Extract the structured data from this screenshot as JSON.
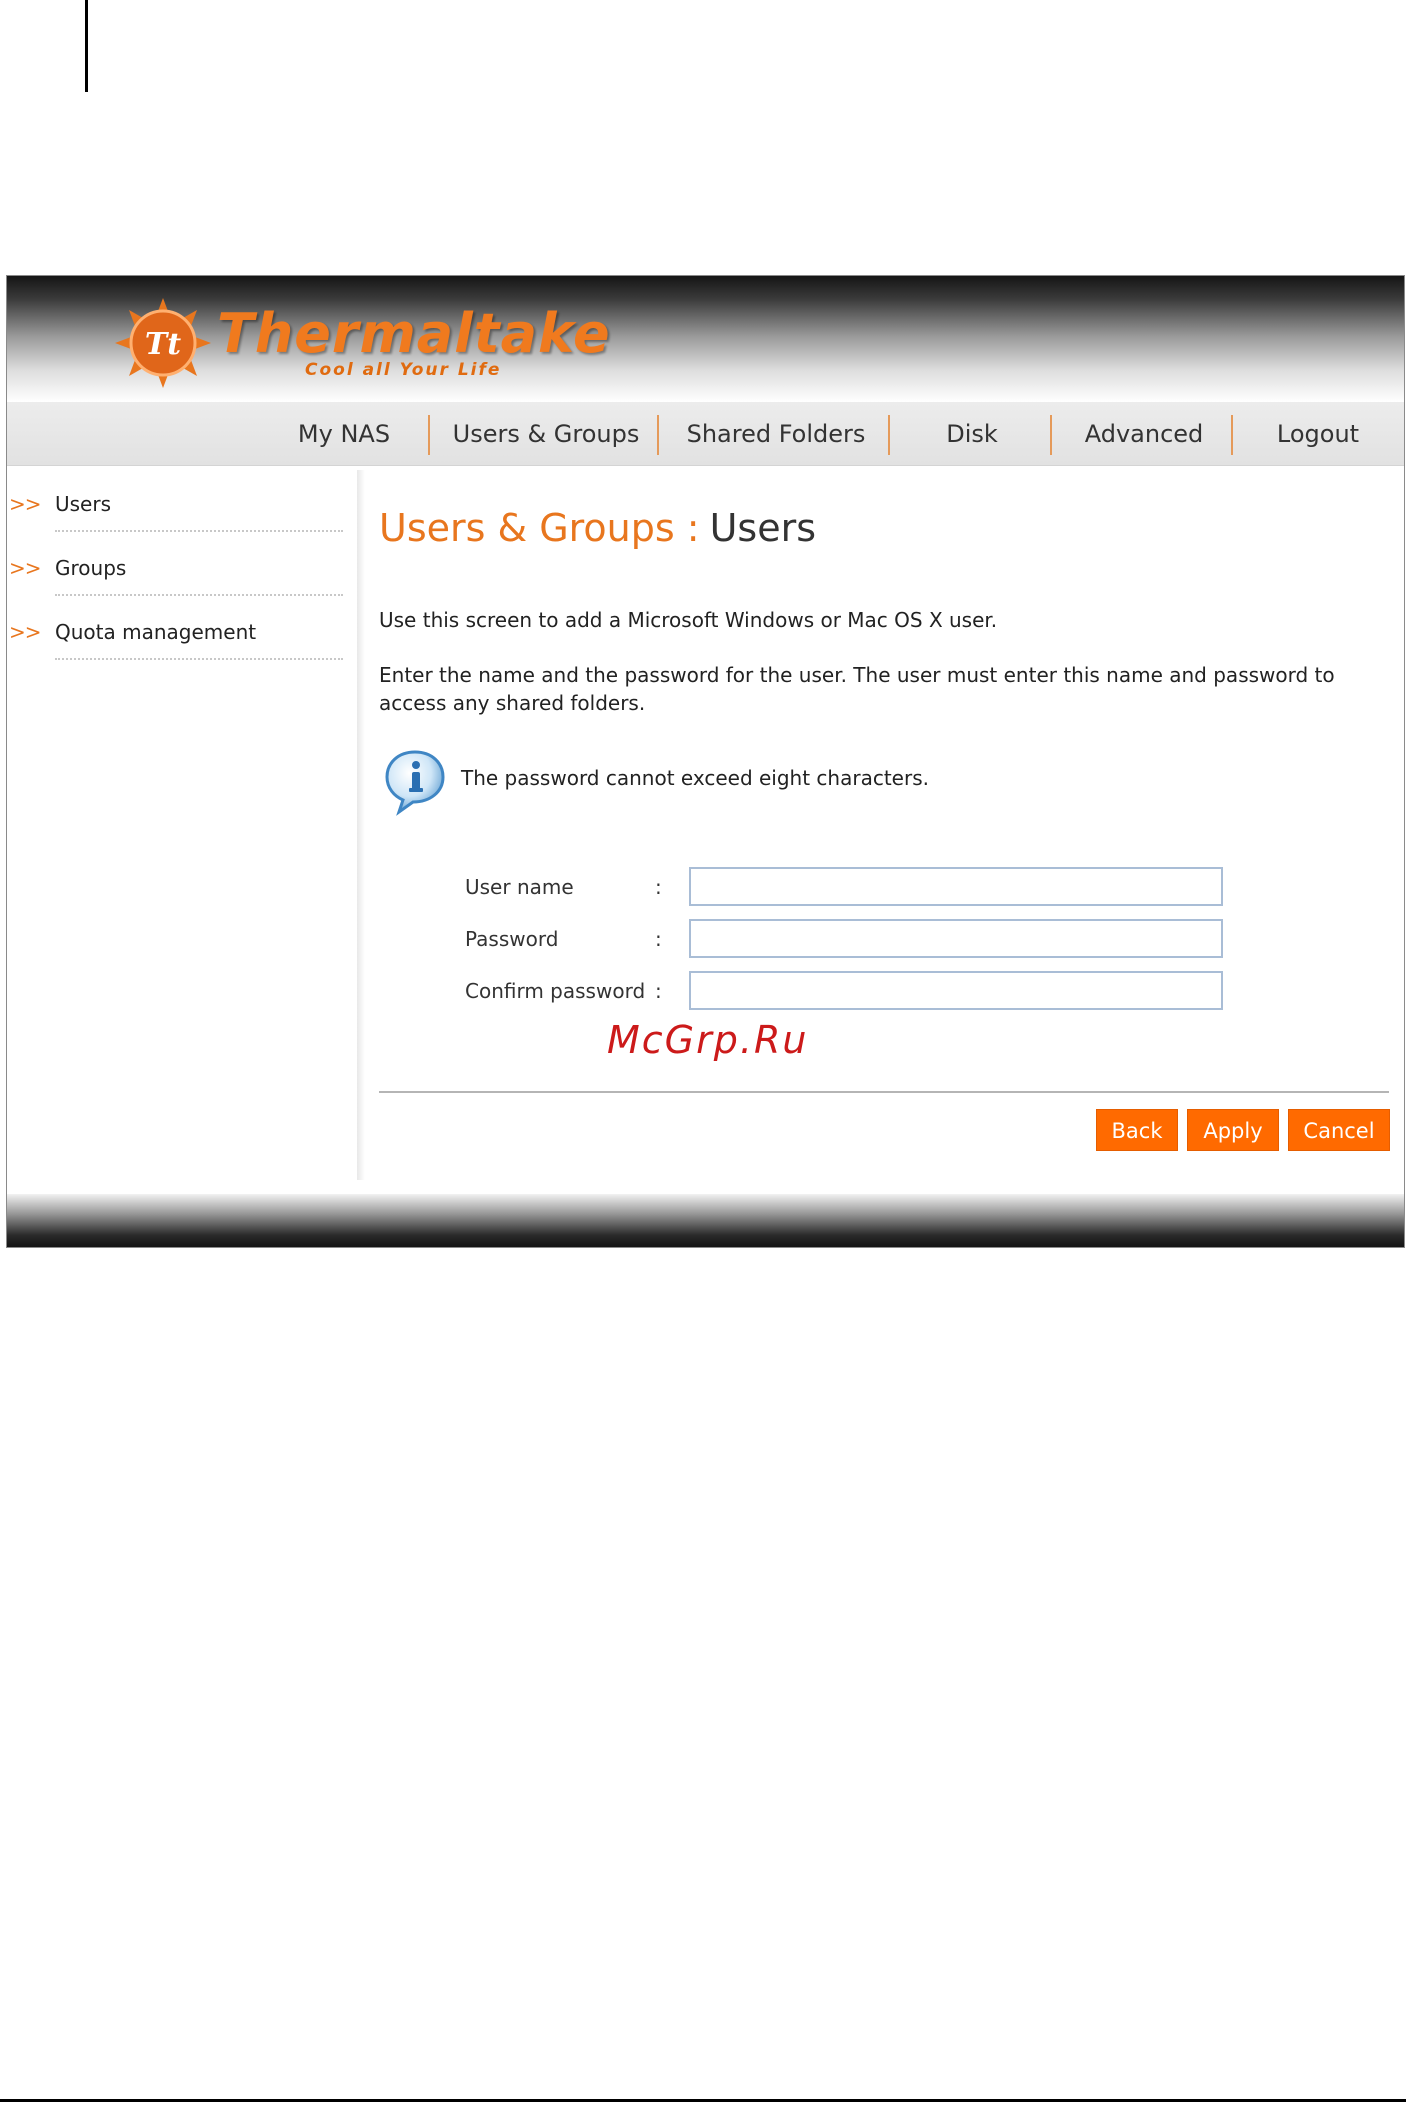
{
  "brand": {
    "name": "Thermaltake",
    "tagline": "Cool all Your Life",
    "logo_mark": "Tt",
    "accent_color": "#e8761e"
  },
  "nav": {
    "items": [
      {
        "label": "My NAS"
      },
      {
        "label": "Users & Groups"
      },
      {
        "label": "Shared Folders"
      },
      {
        "label": "Disk"
      },
      {
        "label": "Advanced"
      },
      {
        "label": "Logout"
      }
    ]
  },
  "sidebar": {
    "arrow": ">>",
    "items": [
      {
        "label": "Users"
      },
      {
        "label": "Groups"
      },
      {
        "label": "Quota management"
      }
    ]
  },
  "main": {
    "title_section": "Users & Groups :",
    "title_page": "Users",
    "description_1": "Use this screen to add a Microsoft Windows or Mac OS X user.",
    "description_2": "Enter the name and the password for the user. The user must enter this name and password to access any shared folders.",
    "info_icon": "info-bubble-icon",
    "info_text": "The password cannot exceed eight characters."
  },
  "form": {
    "colon": ":",
    "fields": [
      {
        "label": "User name",
        "value": ""
      },
      {
        "label": "Password",
        "value": ""
      },
      {
        "label": "Confirm password",
        "value": ""
      }
    ]
  },
  "buttons": {
    "back": "Back",
    "apply": "Apply",
    "cancel": "Cancel",
    "color": "#ff6a00"
  },
  "watermark": "McGrp.Ru"
}
